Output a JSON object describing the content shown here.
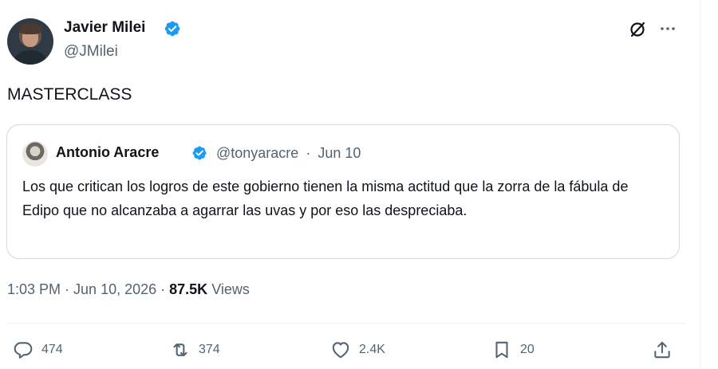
{
  "author": {
    "name": "Javier Milei",
    "handle": "@JMilei",
    "verified": true
  },
  "tweet": {
    "text": "MASTERCLASS"
  },
  "quoted_tweet": {
    "author_name": "Antonio Aracre",
    "handle": "@tonyaracre",
    "separator": "·",
    "date": "Jun 10",
    "text": "Los que critican los logros de este gobierno tienen la misma actitud que la zorra de la fábula de Edipo que no alcanzaba a agarrar las uvas y por eso las despreciaba."
  },
  "meta": {
    "time": "1:03 PM",
    "separator1": " · ",
    "date": "Jun 10, 2026",
    "separator2": " · ",
    "views_count": "87.5K",
    "views_label": " Views"
  },
  "actions": {
    "reply_count": "474",
    "retweet_count": "374",
    "like_count": "2.4K",
    "bookmark_count": "20"
  },
  "icons": {
    "verified": "verified-badge-icon",
    "grok": "grok-icon",
    "more": "more-icon",
    "reply": "reply-icon",
    "retweet": "retweet-icon",
    "like": "heart-icon",
    "bookmark": "bookmark-icon",
    "share": "share-icon"
  },
  "colors": {
    "verified": "#1d9bf0",
    "secondary_text": "#536471",
    "primary_text": "#0f1419",
    "border": "#cfd9de"
  }
}
